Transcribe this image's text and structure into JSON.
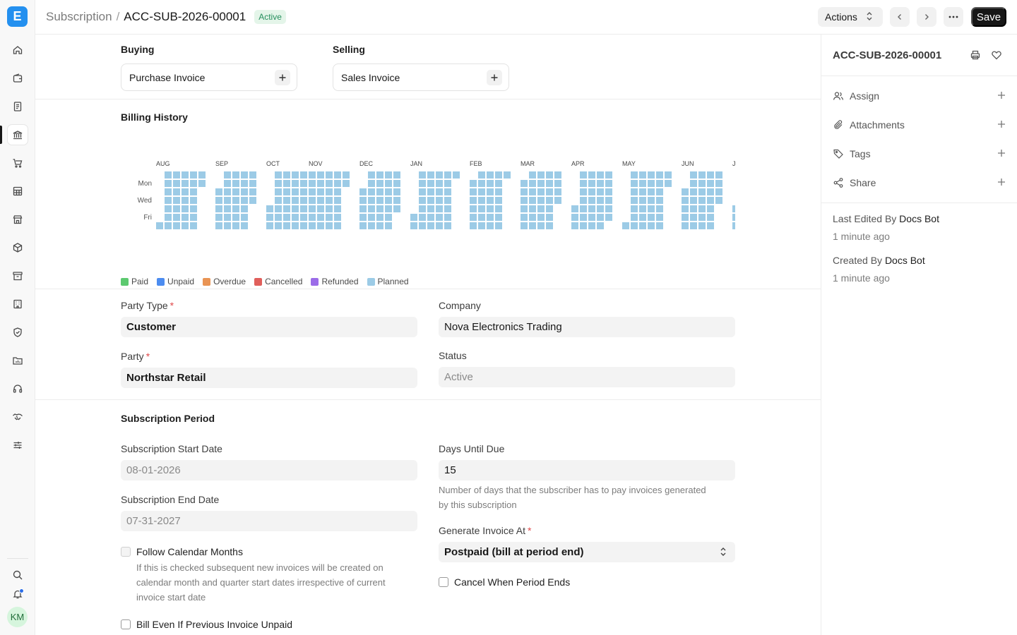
{
  "app": {
    "logo_letter": "E"
  },
  "rail": {
    "icons": [
      "home-icon",
      "wallet-icon",
      "invoice-icon",
      "bank-icon",
      "cart-icon",
      "table-icon",
      "store-icon",
      "box-icon",
      "archive-icon",
      "building-icon",
      "shield-icon",
      "folder-chart-icon",
      "headset-icon",
      "handshake-icon",
      "sliders-icon"
    ],
    "bottom": [
      "search-icon",
      "bell-icon"
    ],
    "avatar_initials": "KM"
  },
  "header": {
    "doctype": "Subscription",
    "separator": "/",
    "doc_name": "ACC-SUB-2026-00001",
    "status_badge": "Active",
    "actions_label": "Actions",
    "save_label": "Save"
  },
  "links": {
    "buying_title": "Buying",
    "buying_item": "Purchase Invoice",
    "selling_title": "Selling",
    "selling_item": "Sales Invoice"
  },
  "billing_history": {
    "title": "Billing History",
    "months": [
      "AUG",
      "SEP",
      "OCT",
      "NOV",
      "DEC",
      "JAN",
      "FEB",
      "MAR",
      "APR",
      "MAY",
      "JUN",
      "JUL"
    ],
    "day_labels": [
      "Mon",
      "Wed",
      "Fri"
    ],
    "legend": [
      {
        "label": "Paid",
        "color": "#5cc96f"
      },
      {
        "label": "Unpaid",
        "color": "#4c8cf0"
      },
      {
        "label": "Overdue",
        "color": "#e99454"
      },
      {
        "label": "Cancelled",
        "color": "#e05f5b"
      },
      {
        "label": "Refunded",
        "color": "#9b6ce8"
      },
      {
        "label": "Planned",
        "color": "#9ccbe6"
      }
    ],
    "cell_color": "#9ccbe6"
  },
  "party": {
    "party_type_label": "Party Type",
    "party_type_value": "Customer",
    "party_label": "Party",
    "party_value": "Northstar Retail",
    "company_label": "Company",
    "company_value": "Nova Electronics Trading",
    "status_label": "Status",
    "status_value": "Active",
    "required_mark": "*"
  },
  "period": {
    "title": "Subscription Period",
    "start_label": "Subscription Start Date",
    "start_value": "08-01-2026",
    "end_label": "Subscription End Date",
    "end_value": "07-31-2027",
    "follow_label": "Follow Calendar Months",
    "follow_help_1": "If this is checked subsequent new invoices will be created on",
    "follow_help_2": "calendar month and quarter start dates irrespective of current",
    "follow_help_3": "invoice start date",
    "bill_unpaid_label": "Bill Even If Previous Invoice Unpaid",
    "days_label": "Days Until Due",
    "days_value": "15",
    "days_help_1": "Number of days that the subscriber has to pay invoices generated",
    "days_help_2": "by this subscription",
    "generate_label": "Generate Invoice At",
    "generate_value": "Postpaid (bill at period end)",
    "cancel_label": "Cancel When Period Ends"
  },
  "sidebar": {
    "doc_name": "ACC-SUB-2026-00001",
    "assign": "Assign",
    "attachments": "Attachments",
    "tags": "Tags",
    "share": "Share",
    "last_edited_prefix": "Last Edited By",
    "last_edited_by": "Docs Bot",
    "last_edited_ago": "1 minute ago",
    "created_prefix": "Created By",
    "created_by": "Docs Bot",
    "created_ago": "1 minute ago"
  }
}
